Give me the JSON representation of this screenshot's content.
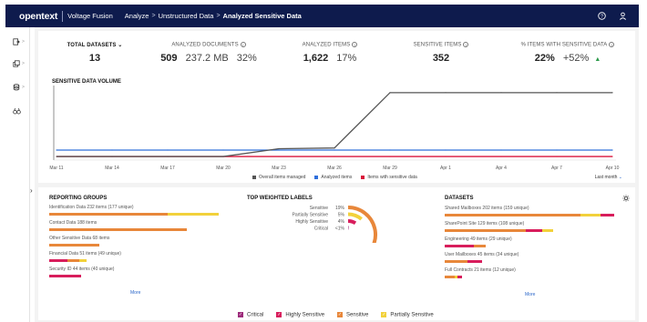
{
  "topbar": {
    "brand": "opentext",
    "product": "Voltage Fusion",
    "breadcrumbs": [
      "Analyze",
      "Unstructured Data",
      "Analyzed Sensitive Data"
    ]
  },
  "kpis": {
    "total_datasets": {
      "label": "TOTAL DATASETS",
      "value": "13"
    },
    "analyzed_documents": {
      "label": "ANALYZED DOCUMENTS",
      "count": "509",
      "size": "237.2 MB",
      "pct": "32%"
    },
    "analyzed_items": {
      "label": "ANALYZED ITEMS",
      "count": "1,622",
      "pct": "17%"
    },
    "sensitive_items": {
      "label": "SENSITIVE ITEMS",
      "value": "352"
    },
    "pct_items_sensitive": {
      "label": "% ITEMS WITH SENSITIVE DATA",
      "value": "22%",
      "change": "+52%"
    }
  },
  "volume": {
    "title": "SENSITIVE DATA VOLUME",
    "period": "Last month",
    "legend": [
      "Overall items managed",
      "Analyzed items",
      "Items with sensitive data"
    ]
  },
  "chart_data": {
    "type": "line",
    "title": "SENSITIVE DATA VOLUME",
    "x": [
      "Mar 11",
      "Mar 14",
      "Mar 17",
      "Mar 20",
      "Mar 23",
      "Mar 26",
      "Mar 29",
      "Apr 1",
      "Apr 4",
      "Apr 7",
      "Apr 10"
    ],
    "series": [
      {
        "name": "Overall items managed",
        "color": "#555555",
        "values": [
          50,
          50,
          50,
          50,
          270,
          290,
          1850,
          1850,
          1850,
          1850,
          1850
        ]
      },
      {
        "name": "Analyzed items",
        "color": "#2f6fdb",
        "values": [
          230,
          230,
          230,
          230,
          230,
          230,
          230,
          230,
          230,
          230,
          230
        ]
      },
      {
        "name": "Items with sensitive data",
        "color": "#d9143a",
        "values": [
          50,
          50,
          50,
          50,
          50,
          50,
          50,
          50,
          50,
          50,
          50
        ]
      }
    ],
    "grid": false,
    "legend_position": "bottom"
  },
  "reporting_groups": {
    "title": "REPORTING GROUPS",
    "more": "More",
    "rows": [
      {
        "label": "Identification Data   232 items (177 unique)",
        "segments": [
          {
            "color": "#e8873a",
            "value": 0.7
          },
          {
            "color": "#f2d13b",
            "value": 0.3
          }
        ]
      },
      {
        "label": "Contact Data   188 items",
        "segments": [
          {
            "color": "#e8873a",
            "value": 1.0
          }
        ]
      },
      {
        "label": "Other Sensitive Data   68 items",
        "segments": [
          {
            "color": "#e8873a",
            "value": 1.0
          }
        ]
      },
      {
        "label": "Financial Data   51 items (49 unique)",
        "segments": [
          {
            "color": "#d81d5c",
            "value": 0.5
          },
          {
            "color": "#e8873a",
            "value": 0.3
          },
          {
            "color": "#f2d13b",
            "value": 0.2
          }
        ]
      },
      {
        "label": "Security ID   44 items (40 unique)",
        "segments": [
          {
            "color": "#d81d5c",
            "value": 1.0
          }
        ]
      }
    ]
  },
  "weighted_labels": {
    "title": "TOP WEIGHTED LABELS",
    "items": [
      {
        "label": "Sensitive",
        "pct": "19%",
        "value": 19,
        "color": "#e8873a"
      },
      {
        "label": "Partially Sensitive",
        "pct": "5%",
        "value": 5,
        "color": "#f2d13b"
      },
      {
        "label": "Highly Sensitive",
        "pct": "4%",
        "value": 4,
        "color": "#d81d5c"
      },
      {
        "label": "Critical",
        "pct": "<1%",
        "value": 0.5,
        "color": "#9c2b7b"
      }
    ]
  },
  "datasets": {
    "title": "DATASETS",
    "more": "More",
    "rows": [
      {
        "label": "Shared Mailboxes   202 items (159 unique)",
        "segments": [
          {
            "color": "#e8873a",
            "value": 0.8
          },
          {
            "color": "#f2d13b",
            "value": 0.12
          },
          {
            "color": "#d81d5c",
            "value": 0.08
          }
        ]
      },
      {
        "label": "SharePoint Site   129 items (108 unique)",
        "segments": [
          {
            "color": "#e8873a",
            "value": 0.75
          },
          {
            "color": "#d81d5c",
            "value": 0.15
          },
          {
            "color": "#f2d13b",
            "value": 0.1
          }
        ]
      },
      {
        "label": "Engineering   49 items (29 unique)",
        "segments": [
          {
            "color": "#d81d5c",
            "value": 0.7
          },
          {
            "color": "#e8873a",
            "value": 0.3
          }
        ]
      },
      {
        "label": "User Mailboxes   45 items (34 unique)",
        "segments": [
          {
            "color": "#e8873a",
            "value": 0.6
          },
          {
            "color": "#d81d5c",
            "value": 0.4
          }
        ]
      },
      {
        "label": "Full Contracts   21 items (12 unique)",
        "segments": [
          {
            "color": "#e8873a",
            "value": 0.55
          },
          {
            "color": "#f2d13b",
            "value": 0.2
          },
          {
            "color": "#d81d5c",
            "value": 0.25
          }
        ]
      }
    ]
  },
  "severity_legend": [
    {
      "label": "Critical",
      "color": "#9c2b7b"
    },
    {
      "label": "Highly Sensitive",
      "color": "#d81d5c"
    },
    {
      "label": "Sensitive",
      "color": "#e8873a"
    },
    {
      "label": "Partially Sensitive",
      "color": "#f2d13b"
    }
  ]
}
